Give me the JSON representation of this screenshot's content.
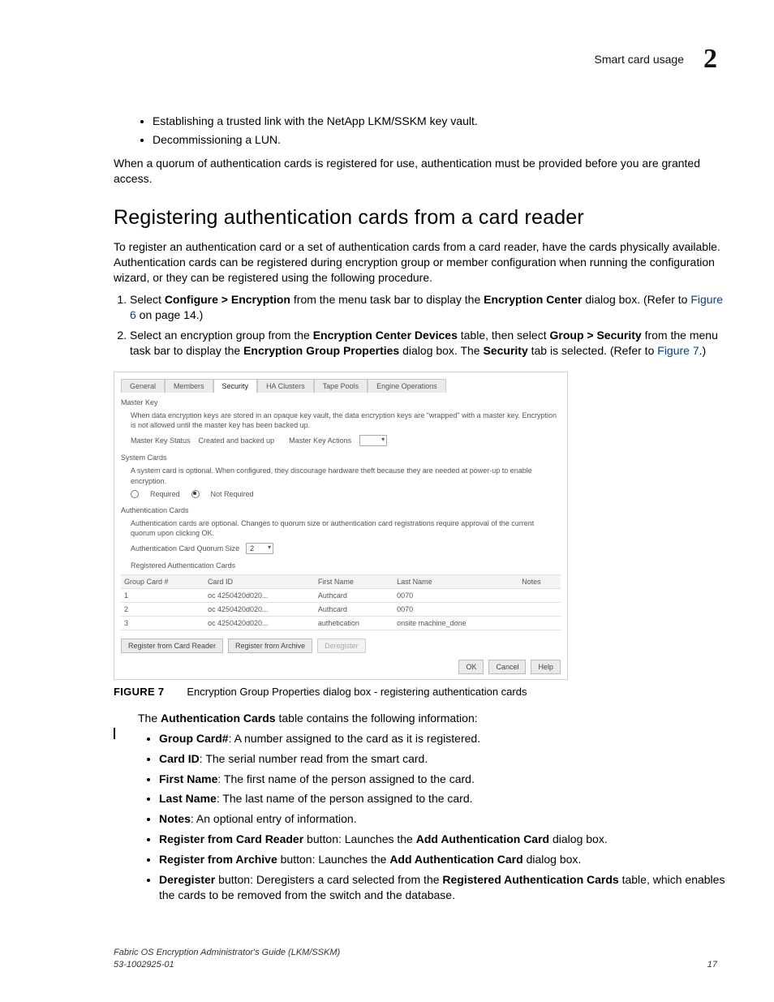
{
  "header": {
    "section": "Smart card usage",
    "chapter": "2"
  },
  "bullets_top": [
    "Establishing a trusted link with the NetApp LKM/SSKM key vault.",
    "Decommissioning a LUN."
  ],
  "para_after_bullets": "When a quorum of authentication cards is registered for use, authentication must be provided before you are granted access.",
  "section_title": "Registering authentication cards from a card reader",
  "section_intro": "To register an authentication card or a set of authentication cards from a card reader, have the cards physically available. Authentication cards can be registered during encryption group or member configuration when running the configuration wizard, or they can be registered using the following procedure.",
  "steps": {
    "s1_a": "Select ",
    "s1_b": "Configure > Encryption",
    "s1_c": " from the menu task bar to display the ",
    "s1_d": "Encryption Center",
    "s1_e": " dialog box. (Refer to ",
    "s1_link": "Figure 6",
    "s1_f": " on page 14.)",
    "s2_a": "Select an encryption group from the ",
    "s2_b": "Encryption Center Devices",
    "s2_c": " table, then select ",
    "s2_d": "Group > Security",
    "s2_e": " from the menu task bar to display the ",
    "s2_f": "Encryption Group Properties",
    "s2_g": " dialog box. The ",
    "s2_h": "Security",
    "s2_i": " tab is selected. (Refer to ",
    "s2_link": "Figure 7",
    "s2_j": ".)"
  },
  "dialog": {
    "tabs": [
      "General",
      "Members",
      "Security",
      "HA Clusters",
      "Tape Pools",
      "Engine Operations"
    ],
    "master_key_label": "Master Key",
    "master_key_text": "When data encryption keys are stored in an opaque key vault, the data encryption keys are \"wrapped\" with a master key. Encryption is not allowed until the master key has been backed up.",
    "mk_status_label": "Master Key Status",
    "mk_status_value": "Created and backed up",
    "mk_actions_label": "Master Key Actions",
    "system_cards_label": "System Cards",
    "system_cards_text": "A system card is optional. When configured, they discourage hardware theft because they are needed at power-up to enable encryption.",
    "required": "Required",
    "not_required": "Not Required",
    "auth_cards_label": "Authentication Cards",
    "auth_cards_text": "Authentication cards are optional. Changes to quorum size or authentication card registrations require approval of the current quorum upon clicking OK.",
    "quorum_label": "Authentication Card Quorum Size",
    "quorum_value": "2",
    "reg_table_label": "Registered Authentication Cards",
    "columns": [
      "Group Card #",
      "Card ID",
      "First Name",
      "Last Name",
      "Notes"
    ],
    "rows": [
      {
        "num": "1",
        "id": "oc 4250420d020...",
        "first": "Authcard",
        "last": "0070",
        "notes": ""
      },
      {
        "num": "2",
        "id": "oc 4250420d020...",
        "first": "Authcard",
        "last": "0070",
        "notes": ""
      },
      {
        "num": "3",
        "id": "oc 4250420d020...",
        "first": "authetication",
        "last": "onsite machine_done",
        "notes": ""
      }
    ],
    "btn_reg_reader": "Register from Card Reader",
    "btn_reg_archive": "Register from Archive",
    "btn_deregister": "Deregister",
    "btn_ok": "OK",
    "btn_cancel": "Cancel",
    "btn_help": "Help"
  },
  "caption": {
    "label": "FIGURE 7",
    "text": "Encryption Group Properties dialog box - registering authentication cards"
  },
  "after_fig_intro_a": "The ",
  "after_fig_intro_b": "Authentication Cards",
  "after_fig_intro_c": " table contains the following information:",
  "info_items": {
    "i1b": "Group Card#",
    "i1t": ": A number assigned to the card as it is registered.",
    "i2b": "Card ID",
    "i2t": ": The serial number read from the smart card.",
    "i3b": "First Name",
    "i3t": ": The first name of the person assigned to the card.",
    "i4b": "Last Name",
    "i4t": ": The last name of the person assigned to the card.",
    "i5b": "Notes",
    "i5t": ": An optional entry of information.",
    "i6b1": "Register from Card Reader",
    "i6t1": " button: Launches the ",
    "i6b2": "Add Authentication Card",
    "i6t2": " dialog box.",
    "i7b1": "Register from Archive",
    "i7t1": " button: Launches the ",
    "i7b2": "Add Authentication Card",
    "i7t2": " dialog box.",
    "i8b1": "Deregister",
    "i8t1": " button: Deregisters a card selected from the ",
    "i8b2": "Registered Authentication Cards",
    "i8t2": " table, which enables the cards to be removed from the switch and the database."
  },
  "footer": {
    "left1": "Fabric OS Encryption Administrator's Guide  (LKM/SSKM)",
    "left2": "53-1002925-01",
    "right": "17"
  }
}
